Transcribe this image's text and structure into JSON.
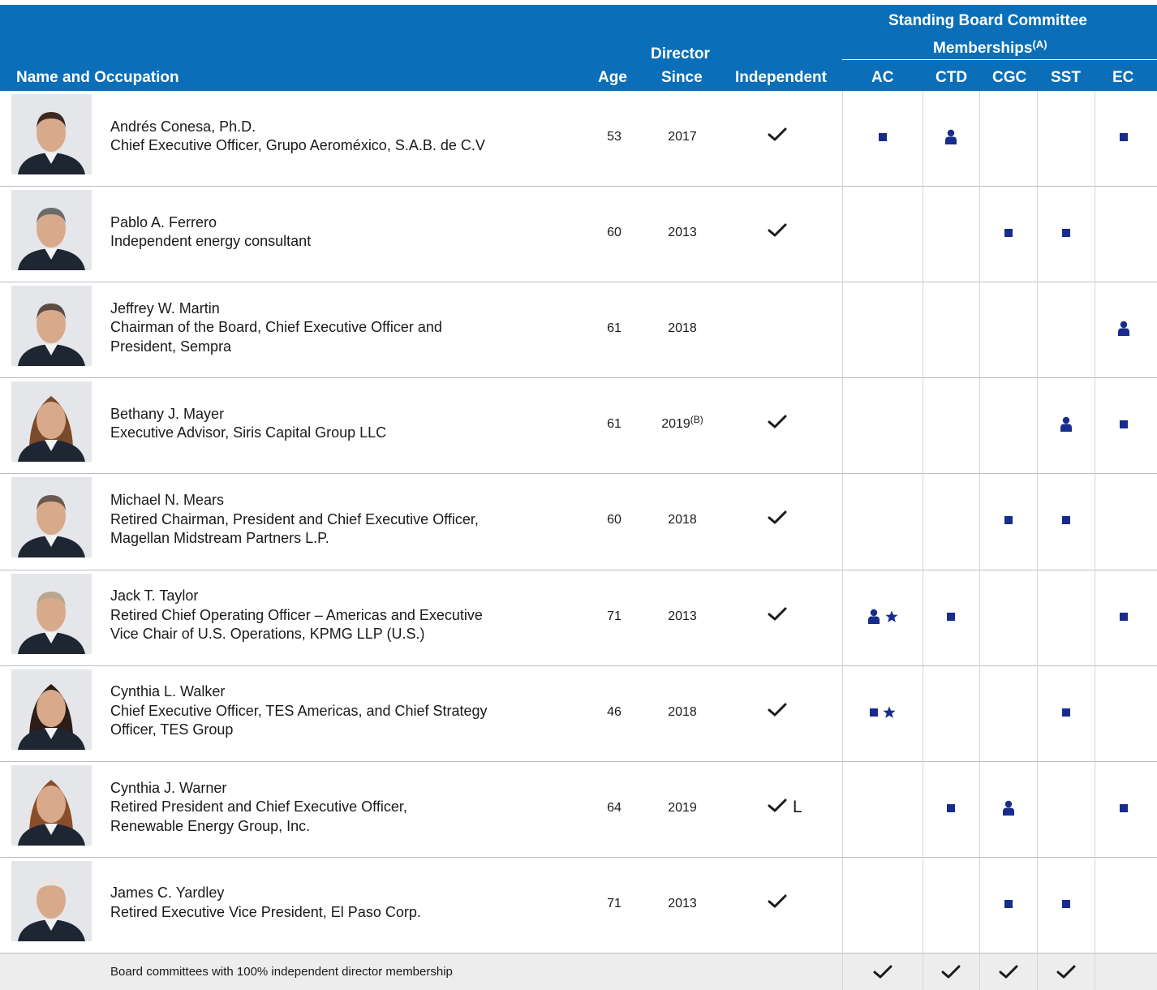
{
  "header": {
    "name_occupation": "Name and Occupation",
    "age": "Age",
    "director_line1": "Director",
    "director_line2": "Since",
    "independent": "Independent",
    "committee_group_line1": "Standing Board Committee",
    "committee_group_line2": "Memberships",
    "committee_group_note": "(A)",
    "committees": [
      "AC",
      "CTD",
      "CGC",
      "SST",
      "EC"
    ]
  },
  "legend_icons": {
    "member": "member-square-icon",
    "chair": "chair-person-icon",
    "financial_expert": "star-icon",
    "independent": "checkmark-icon"
  },
  "colors": {
    "header_bg": "#0a6fb8",
    "mark": "#172c8c",
    "footer_bg": "#ededed"
  },
  "directors": [
    {
      "name": "Andrés Conesa, Ph.D.",
      "occupation": [
        "Chief Executive Officer, Grupo Aeroméxico, S.A.B. de C.V"
      ],
      "age": "53",
      "since": "2017",
      "since_note": "",
      "independent": true,
      "lead": "",
      "marks": {
        "AC": [
          "member"
        ],
        "CTD": [
          "chair"
        ],
        "CGC": [],
        "SST": [],
        "EC": [
          "member"
        ]
      }
    },
    {
      "name": "Pablo A. Ferrero",
      "occupation": [
        "Independent energy consultant"
      ],
      "age": "60",
      "since": "2013",
      "since_note": "",
      "independent": true,
      "lead": "",
      "marks": {
        "AC": [],
        "CTD": [],
        "CGC": [
          "member"
        ],
        "SST": [
          "member"
        ],
        "EC": []
      }
    },
    {
      "name": "Jeffrey W. Martin",
      "occupation": [
        "Chairman of the Board, Chief Executive Officer and",
        "President, Sempra"
      ],
      "age": "61",
      "since": "2018",
      "since_note": "",
      "independent": false,
      "lead": "",
      "marks": {
        "AC": [],
        "CTD": [],
        "CGC": [],
        "SST": [],
        "EC": [
          "chair"
        ]
      }
    },
    {
      "name": "Bethany J. Mayer",
      "occupation": [
        "Executive Advisor, Siris Capital Group LLC"
      ],
      "age": "61",
      "since": "2019",
      "since_note": "(B)",
      "independent": true,
      "lead": "",
      "marks": {
        "AC": [],
        "CTD": [],
        "CGC": [],
        "SST": [
          "chair"
        ],
        "EC": [
          "member"
        ]
      }
    },
    {
      "name": "Michael N. Mears",
      "occupation": [
        "Retired Chairman, President and Chief Executive Officer,",
        "Magellan Midstream Partners L.P."
      ],
      "age": "60",
      "since": "2018",
      "since_note": "",
      "independent": true,
      "lead": "",
      "marks": {
        "AC": [],
        "CTD": [],
        "CGC": [
          "member"
        ],
        "SST": [
          "member"
        ],
        "EC": []
      }
    },
    {
      "name": "Jack T. Taylor",
      "occupation": [
        "Retired Chief Operating Officer – Americas and Executive",
        "Vice Chair of U.S. Operations, KPMG LLP (U.S.)"
      ],
      "age": "71",
      "since": "2013",
      "since_note": "",
      "independent": true,
      "lead": "",
      "marks": {
        "AC": [
          "chair",
          "star"
        ],
        "CTD": [
          "member"
        ],
        "CGC": [],
        "SST": [],
        "EC": [
          "member"
        ]
      }
    },
    {
      "name": "Cynthia L. Walker",
      "occupation": [
        "Chief Executive Officer, TES Americas, and Chief Strategy",
        "Officer, TES Group"
      ],
      "age": "46",
      "since": "2018",
      "since_note": "",
      "independent": true,
      "lead": "",
      "marks": {
        "AC": [
          "member",
          "star"
        ],
        "CTD": [],
        "CGC": [],
        "SST": [
          "member"
        ],
        "EC": []
      }
    },
    {
      "name": "Cynthia J. Warner",
      "occupation": [
        "Retired President and Chief Executive Officer,",
        "Renewable Energy Group, Inc."
      ],
      "age": "64",
      "since": "2019",
      "since_note": "",
      "independent": true,
      "lead": "L",
      "marks": {
        "AC": [],
        "CTD": [
          "member"
        ],
        "CGC": [
          "chair"
        ],
        "SST": [],
        "EC": [
          "member"
        ]
      }
    },
    {
      "name": "James C. Yardley",
      "occupation": [
        "Retired Executive Vice President, El Paso Corp."
      ],
      "age": "71",
      "since": "2013",
      "since_note": "",
      "independent": true,
      "lead": "",
      "marks": {
        "AC": [],
        "CTD": [],
        "CGC": [
          "member"
        ],
        "SST": [
          "member"
        ],
        "EC": []
      }
    }
  ],
  "footer": {
    "text": "Board committees with 100% independent director membership",
    "independent_committees": {
      "AC": true,
      "CTD": true,
      "CGC": true,
      "SST": true,
      "EC": false
    }
  }
}
